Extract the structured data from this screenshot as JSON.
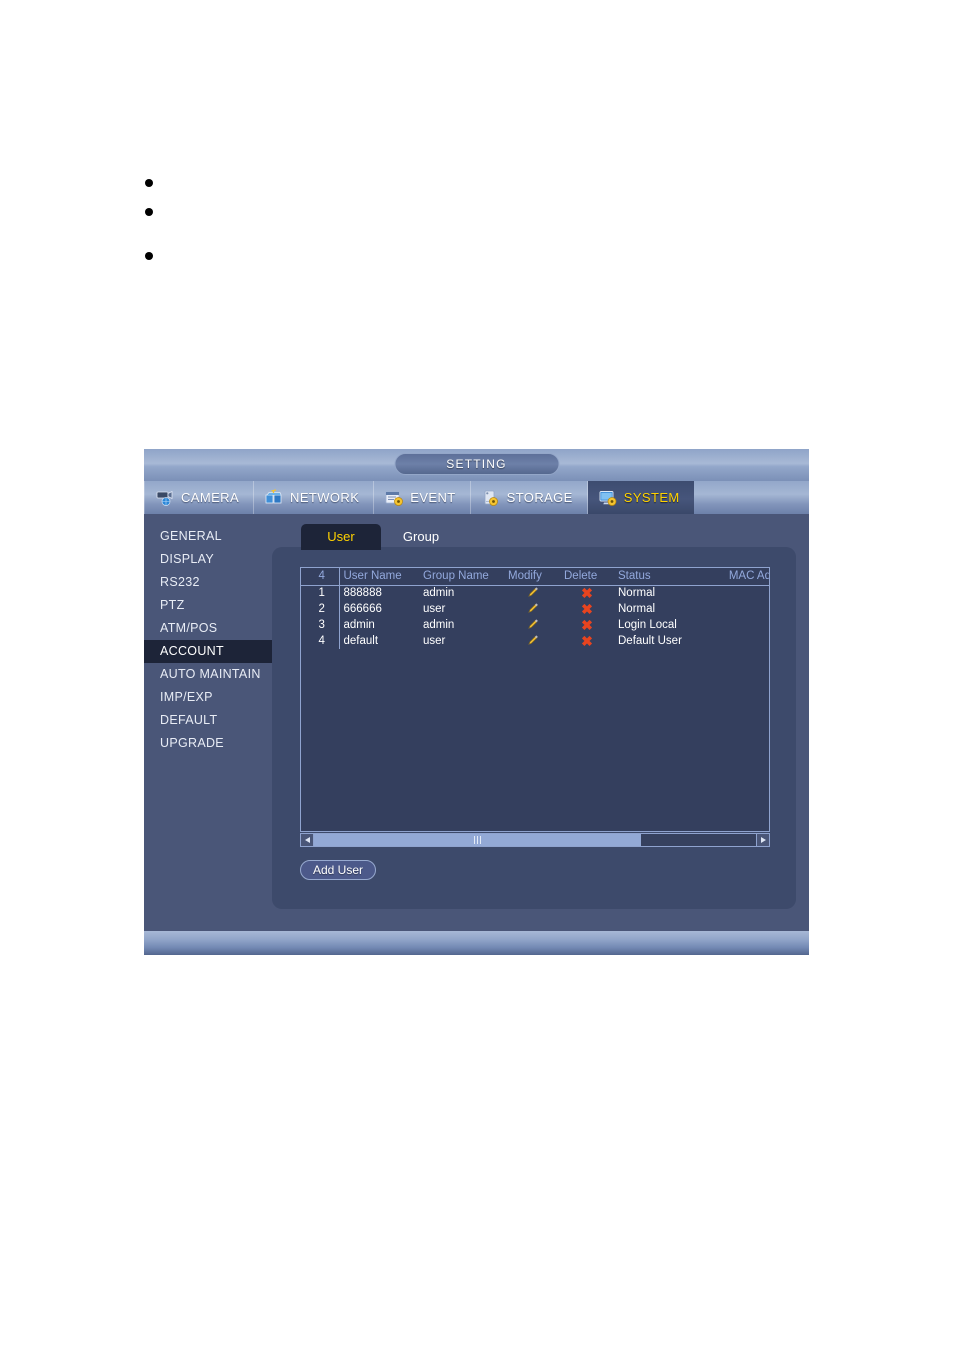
{
  "document": {
    "bullets": [
      "",
      "",
      ""
    ]
  },
  "window": {
    "title": "SETTING",
    "main_tabs": [
      {
        "label": "CAMERA",
        "icon": "camera-icon",
        "active": false
      },
      {
        "label": "NETWORK",
        "icon": "network-icon",
        "active": false
      },
      {
        "label": "EVENT",
        "icon": "event-icon",
        "active": false
      },
      {
        "label": "STORAGE",
        "icon": "storage-icon",
        "active": false
      },
      {
        "label": "SYSTEM",
        "icon": "system-icon",
        "active": true
      }
    ],
    "sidebar": {
      "items": [
        {
          "label": "GENERAL",
          "active": false
        },
        {
          "label": "DISPLAY",
          "active": false
        },
        {
          "label": "RS232",
          "active": false
        },
        {
          "label": "PTZ",
          "active": false
        },
        {
          "label": "ATM/POS",
          "active": false
        },
        {
          "label": "ACCOUNT",
          "active": true
        },
        {
          "label": "AUTO MAINTAIN",
          "active": false
        },
        {
          "label": "IMP/EXP",
          "active": false
        },
        {
          "label": "DEFAULT",
          "active": false
        },
        {
          "label": "UPGRADE",
          "active": false
        }
      ]
    },
    "sub_tabs": [
      {
        "label": "User",
        "active": true
      },
      {
        "label": "Group",
        "active": false
      }
    ],
    "table": {
      "headers": {
        "count": "4",
        "user_name": "User Name",
        "group_name": "Group Name",
        "modify": "Modify",
        "delete": "Delete",
        "status": "Status",
        "mac": "MAC Ad"
      },
      "rows": [
        {
          "idx": "1",
          "user_name": "888888",
          "group_name": "admin",
          "modify_icon": "pencil-icon",
          "delete_icon": "close-x-icon",
          "status": "Normal",
          "mac": ""
        },
        {
          "idx": "2",
          "user_name": "666666",
          "group_name": "user",
          "modify_icon": "pencil-icon",
          "delete_icon": "close-x-icon",
          "status": "Normal",
          "mac": ""
        },
        {
          "idx": "3",
          "user_name": "admin",
          "group_name": "admin",
          "modify_icon": "pencil-icon",
          "delete_icon": "close-x-icon",
          "status": "Login Local",
          "mac": ""
        },
        {
          "idx": "4",
          "user_name": "default",
          "group_name": "user",
          "modify_icon": "pencil-icon",
          "delete_icon": "close-x-icon",
          "status": "Default User",
          "mac": ""
        }
      ]
    },
    "buttons": {
      "add_user": "Add User"
    },
    "colors": {
      "window_bg": "#4a5678",
      "panel_bg": "#3d4a6b",
      "table_bg": "#343f5e",
      "active_tab_text": "#ffd200",
      "active_item_bg": "#1d2438",
      "header_text": "#93a9dd",
      "delete_icon": "#e8441f",
      "pencil_icon": "#f2c23c",
      "scrollbar_thumb": "#93a9d6"
    }
  }
}
